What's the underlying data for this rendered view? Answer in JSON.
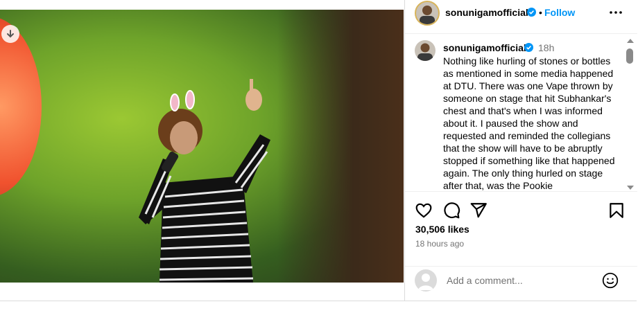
{
  "post": {
    "author": {
      "username": "sonunigamofficial",
      "verified": true
    },
    "follow_label": "Follow",
    "icons": {
      "more": "more-options-icon",
      "download": "download-icon",
      "verified": "verified-badge-icon",
      "like": "heart-icon",
      "comment": "comment-bubble-icon",
      "share": "paper-plane-icon",
      "save": "bookmark-icon",
      "emoji": "emoji-icon"
    },
    "caption": {
      "username": "sonunigamofficial",
      "time": "18h",
      "text": "Nothing like hurling of stones or bottles as mentioned in some media happened at DTU. There was one Vape thrown by someone on stage that hit Subhankar's chest and that's when I was informed about it. I paused the show and requested and reminded the collegians that the show will have to be abruptly stopped if something like that happened again. The only thing hurled on stage after that, was the Pookie"
    },
    "likes": "30,506 likes",
    "posted": "18 hours ago",
    "comment": {
      "placeholder": "Add a comment..."
    },
    "colors": {
      "accent": "#0095f6",
      "verified": "#0095f6",
      "muted": "#737373"
    }
  }
}
